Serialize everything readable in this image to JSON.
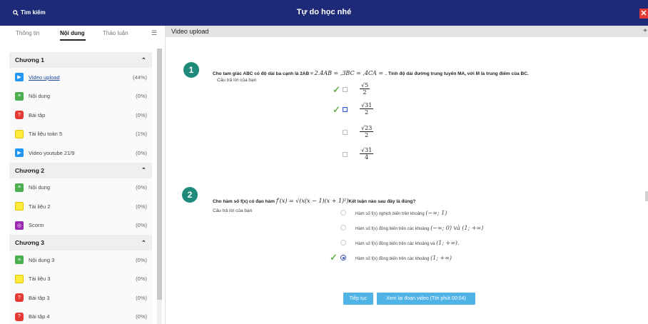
{
  "header": {
    "search_label": "Tìm kiếm",
    "title": "Tự do học nhé",
    "close_label": "✕"
  },
  "tabs": [
    "Thông tin",
    "Nội dung",
    "Thảo luận"
  ],
  "chapters": [
    {
      "title": "Chương 1",
      "items": [
        {
          "label": "Video upload",
          "pct": "(44%)",
          "icon": "play",
          "link": true
        },
        {
          "label": "Nội dung",
          "pct": "(0%)",
          "icon": "doc"
        },
        {
          "label": "Bài tập",
          "pct": "(0%)",
          "icon": "quiz"
        },
        {
          "label": "Tài liệu toán 5",
          "pct": "(1%)",
          "icon": "file"
        },
        {
          "label": "Video youtube 21/9",
          "pct": "(0%)",
          "icon": "play"
        }
      ]
    },
    {
      "title": "Chương 2",
      "items": [
        {
          "label": "Nội dung",
          "pct": "(0%)",
          "icon": "doc"
        },
        {
          "label": "Tài liệu 2",
          "pct": "(0%)",
          "icon": "file"
        },
        {
          "label": "Scorm",
          "pct": "(0%)",
          "icon": "scorm"
        }
      ]
    },
    {
      "title": "Chương 3",
      "items": [
        {
          "label": "Nội dung 3",
          "pct": "(0%)",
          "icon": "doc"
        },
        {
          "label": "Tài liệu 3",
          "pct": "(0%)",
          "icon": "file"
        },
        {
          "label": "Bài tập 3",
          "pct": "(0%)",
          "icon": "quiz"
        },
        {
          "label": "Bài tập 4",
          "pct": "(0%)",
          "icon": "quiz"
        }
      ]
    }
  ],
  "main": {
    "heading": "Video upload",
    "q1": {
      "number": "1",
      "text_a": "Cho tam giác ABC có độ dài ba cạnh là 2AB = ",
      "text_math": "2.4AB = ,3BC = ,4CA = .",
      "text_b": " Tính độ dài đường trung tuyến MA, với M là trung điểm của BC.",
      "answer_label": "Câu trả lời của bạn",
      "options": [
        {
          "num": "√5",
          "den": "2",
          "checked": false,
          "correct": true
        },
        {
          "num": "√31",
          "den": "2",
          "checked": true,
          "correct": true
        },
        {
          "num": "√23",
          "den": "2",
          "checked": false,
          "correct": false
        },
        {
          "num": "√31",
          "den": "4",
          "checked": false,
          "correct": false
        }
      ]
    },
    "q2": {
      "number": "2",
      "text_a": "Cho hàm số f(x) có đạo hàm ",
      "text_math": "f′(x) = √(x(x − 1)(x + 1)²)",
      "text_b": "Kết luận nào sau đây là đúng?",
      "answer_label": "Câu trả lời của bạn",
      "options": [
        {
          "text": "Hàm số f(x) nghịch biến trên khoảng ",
          "math": "(−∞; 1)",
          "checked": false
        },
        {
          "text": "Hàm số f(x) đồng biến trên các khoảng ",
          "math": "(−∞; 0) và (1; +∞)",
          "checked": false
        },
        {
          "text": "Hàm số f(x) đồng biến trên các khoảng và ",
          "math": "(1; +∞).",
          "checked": false
        },
        {
          "text": "Hàm số f(x) đồng biến trên các khoảng ",
          "math": "(1; +∞)",
          "checked": true
        }
      ]
    },
    "buttons": {
      "continue": "Tiếp tục",
      "review": "Xem lại đoạn video (Tới phút 00:04)"
    }
  }
}
